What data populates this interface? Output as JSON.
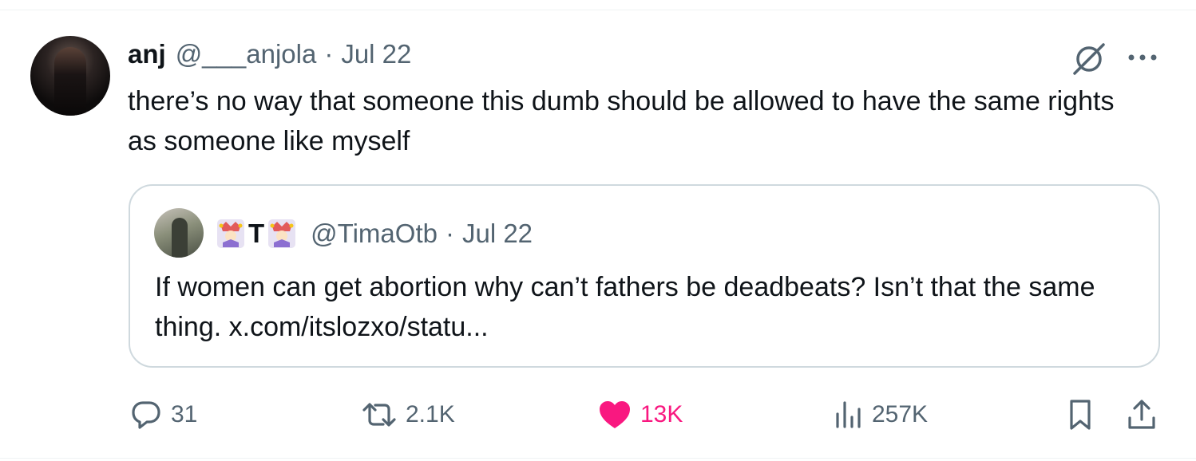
{
  "tweet": {
    "author_name": "anj",
    "author_handle": "@___anjola",
    "separator": "·",
    "date": "Jul 22",
    "text": "there’s no way that someone this dumb should be allowed to have the same rights as someone like myself"
  },
  "quoted_tweet": {
    "author_name_letter": "T",
    "author_handle": "@TimaOtb",
    "separator": "·",
    "date": "Jul 22",
    "text": "If women can get abortion why can’t fathers be deadbeats? Isn’t that the same thing. x.com/itslozxo/statu..."
  },
  "actions": {
    "replies": "31",
    "reposts": "2.1K",
    "likes": "13K",
    "views": "257K"
  },
  "icons": {
    "reply": "reply-bubble-icon",
    "repost": "repost-arrows-icon",
    "like": "heart-icon",
    "views": "analytics-bars-icon",
    "bookmark": "bookmark-icon",
    "share": "share-upload-icon",
    "grok": "grok-slash-circle-icon",
    "more": "more-dots-icon",
    "jester": "jester-emoji-icon"
  },
  "colors": {
    "text": "#0f1419",
    "muted": "#536471",
    "like_active": "#f91880",
    "border": "#cfd9de"
  }
}
